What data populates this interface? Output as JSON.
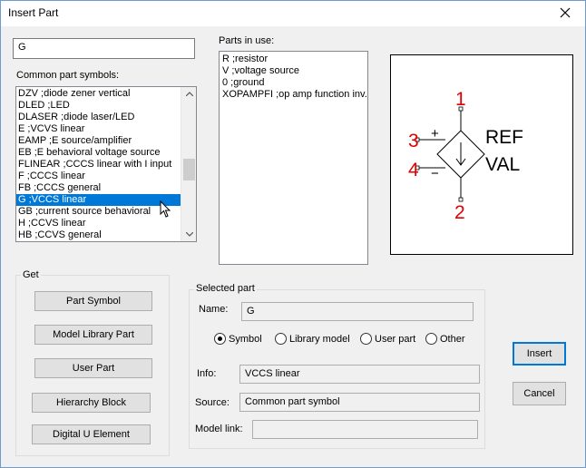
{
  "window": {
    "title": "Insert Part"
  },
  "part_name_input": {
    "value": "G"
  },
  "common_symbols": {
    "label": "Common part symbols:",
    "items": [
      "DZV ;diode zener vertical",
      "DLED ;LED",
      "DLASER ;diode laser/LED",
      "E ;VCVS linear",
      "EAMP ;E source/amplifier",
      "EB ;E behavioral voltage source",
      "FLINEAR ;CCCS linear with I input",
      "F ;CCCS linear",
      "FB ;CCCS general",
      "G ;VCCS linear",
      "GB ;current source behavioral",
      "H ;CCVS linear",
      "HB ;CCVS general"
    ],
    "selected_index": 9,
    "scroll_position": 0.55
  },
  "parts_in_use": {
    "label": "Parts in use:",
    "items": [
      "R ;resistor",
      "V ;voltage source",
      "0 ;ground",
      "XOPAMPFI ;op amp function inv."
    ]
  },
  "preview": {
    "pin_labels": [
      "1",
      "2",
      "3",
      "4"
    ],
    "ref_label": "REF",
    "val_label": "VAL",
    "plus_sign": "+",
    "minus_sign": "−",
    "pin_label_color": "#e00000"
  },
  "get_group": {
    "title": "Get",
    "buttons": [
      "Part Symbol",
      "Model Library Part",
      "User Part",
      "Hierarchy Block",
      "Digital U Element"
    ]
  },
  "selected_part": {
    "title": "Selected part",
    "name_label": "Name:",
    "name_value": "G",
    "radios": [
      "Symbol",
      "Library model",
      "User part",
      "Other"
    ],
    "selected_radio": 0,
    "info_label": "Info:",
    "info_value": "VCCS linear",
    "source_label": "Source:",
    "source_value": "Common part symbol",
    "model_link_label": "Model link:",
    "model_link_value": ""
  },
  "actions": {
    "insert_label": "Insert",
    "cancel_label": "Cancel"
  },
  "colors": {
    "selection": "#0078d7",
    "window_border": "#6b9bd1"
  }
}
